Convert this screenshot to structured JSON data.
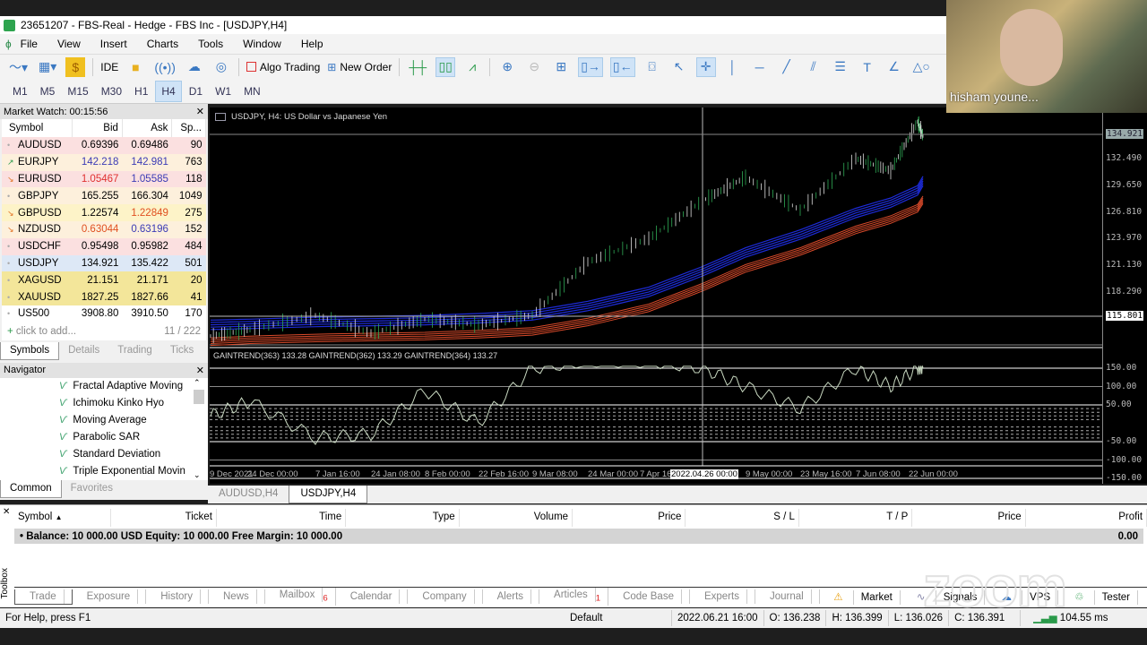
{
  "window": {
    "title": "23651207 - FBS-Real - Hedge - FBS Inc - [USDJPY,H4]"
  },
  "menu": [
    "File",
    "View",
    "Insert",
    "Charts",
    "Tools",
    "Window",
    "Help"
  ],
  "toolbar": {
    "ide": "IDE",
    "algo_trading": "Algo Trading",
    "new_order": "New Order"
  },
  "timeframes": [
    "M1",
    "M5",
    "M15",
    "M30",
    "H1",
    "H4",
    "D1",
    "W1",
    "MN"
  ],
  "active_timeframe": "H4",
  "market_watch": {
    "title": "Market Watch: 00:15:56",
    "columns": [
      "Symbol",
      "Bid",
      "Ask",
      "Sp..."
    ],
    "rows": [
      {
        "symbol": "AUDUSD",
        "bid": "0.69396",
        "ask": "0.69486",
        "spread": "90",
        "dir": "none",
        "bg": "#fbe0e0"
      },
      {
        "symbol": "EURJPY",
        "bid": "142.218",
        "ask": "142.981",
        "spread": "763",
        "dir": "up",
        "bg": "#fdf0dc",
        "bidc": "#3b3bb5",
        "askc": "#3b3bb5"
      },
      {
        "symbol": "EURUSD",
        "bid": "1.05467",
        "ask": "1.05585",
        "spread": "118",
        "dir": "down",
        "bg": "#fbe0e0",
        "bidc": "#e03030",
        "askc": "#3b3bb5"
      },
      {
        "symbol": "GBPJPY",
        "bid": "165.255",
        "ask": "166.304",
        "spread": "1049",
        "dir": "none",
        "bg": "#fdf0dc"
      },
      {
        "symbol": "GBPUSD",
        "bid": "1.22574",
        "ask": "1.22849",
        "spread": "275",
        "dir": "down",
        "bg": "#fdf3c8",
        "askc": "#e05020"
      },
      {
        "symbol": "NZDUSD",
        "bid": "0.63044",
        "ask": "0.63196",
        "spread": "152",
        "dir": "down",
        "bg": "#fdf0dc",
        "bidc": "#e05020",
        "askc": "#3b3bb5"
      },
      {
        "symbol": "USDCHF",
        "bid": "0.95498",
        "ask": "0.95982",
        "spread": "484",
        "dir": "none",
        "bg": "#fbe0e0"
      },
      {
        "symbol": "USDJPY",
        "bid": "134.921",
        "ask": "135.422",
        "spread": "501",
        "dir": "none",
        "bg": "#dde8f6"
      },
      {
        "symbol": "XAGUSD",
        "bid": "21.151",
        "ask": "21.171",
        "spread": "20",
        "dir": "none",
        "bg": "#f3e69a"
      },
      {
        "symbol": "XAUUSD",
        "bid": "1827.25",
        "ask": "1827.66",
        "spread": "41",
        "dir": "none",
        "bg": "#f3e69a"
      },
      {
        "symbol": "US500",
        "bid": "3908.80",
        "ask": "3910.50",
        "spread": "170",
        "dir": "none",
        "bg": "#ffffff"
      }
    ],
    "add_text": "click to add...",
    "count": "11 / 222",
    "tabs": [
      "Symbols",
      "Details",
      "Trading",
      "Ticks"
    ]
  },
  "navigator": {
    "title": "Navigator",
    "items": [
      "Fractal Adaptive Moving",
      "Ichimoku Kinko Hyo",
      "Moving Average",
      "Parabolic SAR",
      "Standard Deviation",
      "Triple Exponential Movin"
    ],
    "tabs": [
      "Common",
      "Favorites"
    ]
  },
  "chart": {
    "title": "USDJPY, H4:  US Dollar vs Japanese Yen",
    "indicator_label": "GAINTREND(363) 133.28 GAINTREND(362) 133.29 GAINTREND(364) 133.27",
    "crosshair_time": "2022.04.26 00:00",
    "tabs": [
      "AUDUSD,H4",
      "USDJPY,H4"
    ],
    "active_tab": "USDJPY,H4"
  },
  "chart_data": {
    "type": "line",
    "x_ticks": [
      "9 Dec 2021",
      "24 Dec 00:00",
      "7 Jan 16:00",
      "24 Jan 08:00",
      "8 Feb 00:00",
      "22 Feb 16:00",
      "9 Mar 08:00",
      "24 Mar 00:00",
      "7 Apr 16:00",
      "9 May 00:00",
      "23 May 16:00",
      "7 Jun 08:00",
      "22 Jun 00:00"
    ],
    "price_ticks": [
      "132.490",
      "129.650",
      "126.810",
      "123.970",
      "121.130",
      "118.290"
    ],
    "price_current": "134.921",
    "price_crosshair": "115.801",
    "ylim": [
      113.0,
      136.5
    ],
    "x": [
      "9 Dec",
      "24 Dec",
      "7 Jan",
      "24 Jan",
      "8 Feb",
      "22 Feb",
      "9 Mar",
      "24 Mar",
      "7 Apr",
      "26 Apr",
      "9 May",
      "23 May",
      "7 Jun",
      "14 Jun",
      "22 Jun",
      "24 Jun"
    ],
    "price": [
      113.6,
      114.3,
      115.8,
      113.9,
      115.4,
      114.8,
      115.8,
      121.5,
      124.0,
      128.0,
      130.5,
      127.0,
      132.5,
      131.2,
      136.4,
      134.9
    ],
    "ma_blue": [
      114.3,
      114.4,
      114.6,
      114.7,
      114.8,
      115.0,
      115.3,
      116.3,
      117.8,
      120.0,
      122.0,
      123.9,
      126.2,
      127.3,
      128.6,
      129.6
    ],
    "ma_red": [
      113.4,
      113.6,
      113.8,
      113.9,
      114.0,
      114.2,
      114.5,
      115.5,
      117.0,
      119.2,
      121.2,
      123.0,
      125.3,
      126.4,
      127.6,
      128.5
    ],
    "indicator": [
      20,
      60,
      -40,
      -30,
      90,
      0,
      150,
      170,
      170,
      150,
      100,
      40,
      150,
      100,
      150,
      150
    ],
    "indicator_ticks": [
      "150.00",
      "100.00",
      "50.00",
      "-50.00",
      "-100.00",
      "-150.00"
    ],
    "indicator_ylim": [
      -160,
      160
    ],
    "colors": {
      "price": "#2faa55",
      "ma_blue": "#1d2bd8",
      "ma_red": "#d84a2a",
      "indicator": "#c8d8c0"
    }
  },
  "toolbox": {
    "columns": [
      "Symbol",
      "Ticket",
      "Time",
      "Type",
      "Volume",
      "Price",
      "S / L",
      "T / P",
      "Price",
      "Profit"
    ],
    "balance": "Balance: 10 000.00 USD  Equity: 10 000.00  Free Margin: 10 000.00",
    "profit": "0.00",
    "tabs": [
      "Trade",
      "Exposure",
      "History",
      "News",
      "Mailbox",
      "Calendar",
      "Company",
      "Alerts",
      "Articles",
      "Code Base",
      "Experts",
      "Journal"
    ],
    "mailbox_badge": "6",
    "articles_badge": "1",
    "right_tabs": [
      "Market",
      "Signals",
      "VPS",
      "Tester"
    ],
    "side_label": "Toolbox"
  },
  "status": {
    "help": "For Help, press F1",
    "profile": "Default",
    "time": "2022.06.21 16:00",
    "open": "O: 136.238",
    "high": "H: 136.399",
    "low": "L: 136.026",
    "close": "C: 136.391",
    "ping": "104.55 ms"
  },
  "webcam": {
    "name": "hisham youne..."
  },
  "watermark": "zoom"
}
